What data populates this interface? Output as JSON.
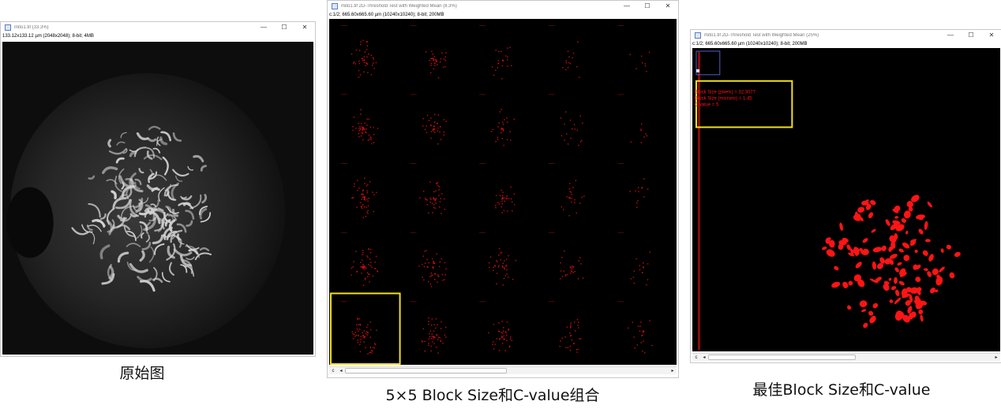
{
  "window_controls": {
    "minimize": "—",
    "maximize": "☐",
    "close": "✕"
  },
  "scroll": {
    "left_arrow": "◂",
    "right_arrow": "▸",
    "c_label": "c"
  },
  "windows": [
    {
      "title": "mito1.tif (33.3%)",
      "info": "133.12x133.12 µm (2048x2048); 8-bit; 4MB",
      "caption": "原始图"
    },
    {
      "title": "mito1.tif 2D-Threshold Test with Weighted Mean (8.3%)",
      "info": "c:1/2; 665.60x665.60 µm (10240x10240); 8-bit; 200MB",
      "caption": "5×5 Block Size和C-value组合"
    },
    {
      "title": "mito1.tif 2D-Threshold Test with Weighted Mean (25%)",
      "info": "c:1/2; 665.60x665.60 µm (10240x10240); 8-bit; 200MB",
      "caption": "最佳Block Size和C-value",
      "annotation": [
        "Block Size (pixels) = 32.3077",
        "Block Size (microns) = 1.45",
        "C value = 5"
      ]
    }
  ],
  "colors": {
    "highlight": "#f2e11c",
    "signal": "#ff1414",
    "canvas_bg": "#000000",
    "block_outline": "#5060c8"
  }
}
